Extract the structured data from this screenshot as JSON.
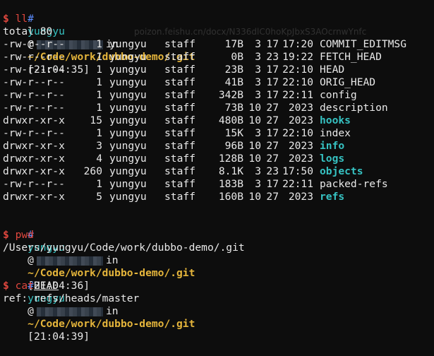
{
  "prompt_blocks": [
    {
      "hash": "#",
      "user": "yungyu",
      "at": "@",
      "in": "in",
      "path": "~/Code/work/dubbo-demo/.git",
      "time": "[21:04:35]",
      "cmd": "ll",
      "arg": ""
    },
    {
      "hash": "#",
      "user": "yungyu",
      "at": "@",
      "in": "in",
      "path": "~/Code/work/dubbo-demo/.git",
      "time": "[21:04:36]",
      "cmd": "pwd",
      "arg": ""
    },
    {
      "hash": "#",
      "user": "yungyu",
      "at": "@",
      "in": "in",
      "path": "~/Code/work/dubbo-demo/.git",
      "time": "[21:04:39]",
      "cmd": "cat",
      "arg": "HEAD"
    }
  ],
  "prompt_symbol": "$",
  "ll_total": "total 80",
  "ll_rows": [
    {
      "perm": "-rw-r--r--",
      "links": "1",
      "owner": "yungyu",
      "group": "staff",
      "size": "17B",
      "mon": "3",
      "day": "17",
      "time": "17:20",
      "name": "COMMIT_EDITMSG",
      "dir": false
    },
    {
      "perm": "-rw-r--r--",
      "links": "1",
      "owner": "yungyu",
      "group": "staff",
      "size": "0B",
      "mon": "3",
      "day": "23",
      "time": "19:22",
      "name": "FETCH_HEAD",
      "dir": false
    },
    {
      "perm": "-rw-r--r--",
      "links": "1",
      "owner": "yungyu",
      "group": "staff",
      "size": "23B",
      "mon": "3",
      "day": "17",
      "time": "22:10",
      "name": "HEAD",
      "dir": false
    },
    {
      "perm": "-rw-r--r--",
      "links": "1",
      "owner": "yungyu",
      "group": "staff",
      "size": "41B",
      "mon": "3",
      "day": "17",
      "time": "22:10",
      "name": "ORIG_HEAD",
      "dir": false
    },
    {
      "perm": "-rw-r--r--",
      "links": "1",
      "owner": "yungyu",
      "group": "staff",
      "size": "342B",
      "mon": "3",
      "day": "17",
      "time": "22:11",
      "name": "config",
      "dir": false
    },
    {
      "perm": "-rw-r--r--",
      "links": "1",
      "owner": "yungyu",
      "group": "staff",
      "size": "73B",
      "mon": "10",
      "day": "27",
      "time": "2023",
      "name": "description",
      "dir": false
    },
    {
      "perm": "drwxr-xr-x",
      "links": "15",
      "owner": "yungyu",
      "group": "staff",
      "size": "480B",
      "mon": "10",
      "day": "27",
      "time": "2023",
      "name": "hooks",
      "dir": true
    },
    {
      "perm": "-rw-r--r--",
      "links": "1",
      "owner": "yungyu",
      "group": "staff",
      "size": "15K",
      "mon": "3",
      "day": "17",
      "time": "22:10",
      "name": "index",
      "dir": false
    },
    {
      "perm": "drwxr-xr-x",
      "links": "3",
      "owner": "yungyu",
      "group": "staff",
      "size": "96B",
      "mon": "10",
      "day": "27",
      "time": "2023",
      "name": "info",
      "dir": true
    },
    {
      "perm": "drwxr-xr-x",
      "links": "4",
      "owner": "yungyu",
      "group": "staff",
      "size": "128B",
      "mon": "10",
      "day": "27",
      "time": "2023",
      "name": "logs",
      "dir": true
    },
    {
      "perm": "drwxr-xr-x",
      "links": "260",
      "owner": "yungyu",
      "group": "staff",
      "size": "8.1K",
      "mon": "3",
      "day": "23",
      "time": "17:50",
      "name": "objects",
      "dir": true
    },
    {
      "perm": "-rw-r--r--",
      "links": "1",
      "owner": "yungyu",
      "group": "staff",
      "size": "183B",
      "mon": "3",
      "day": "17",
      "time": "22:11",
      "name": "packed-refs",
      "dir": false
    },
    {
      "perm": "drwxr-xr-x",
      "links": "5",
      "owner": "yungyu",
      "group": "staff",
      "size": "160B",
      "mon": "10",
      "day": "27",
      "time": "2023",
      "name": "refs",
      "dir": true
    }
  ],
  "pwd_output": "/Users/yungyu/Code/work/dubbo-demo/.git",
  "cat_output": "ref: refs/heads/master",
  "colors": {
    "user": "#36c2c2",
    "path": "#e5b53b",
    "prompt": "#e0473e",
    "dir": "#36c2c2",
    "background": "#0d0d0d"
  },
  "background_ghost": {
    "url": "poizon.feishu.cn/docx/N336dlC0hoKpJbxS3AOcrnwYnfc"
  }
}
